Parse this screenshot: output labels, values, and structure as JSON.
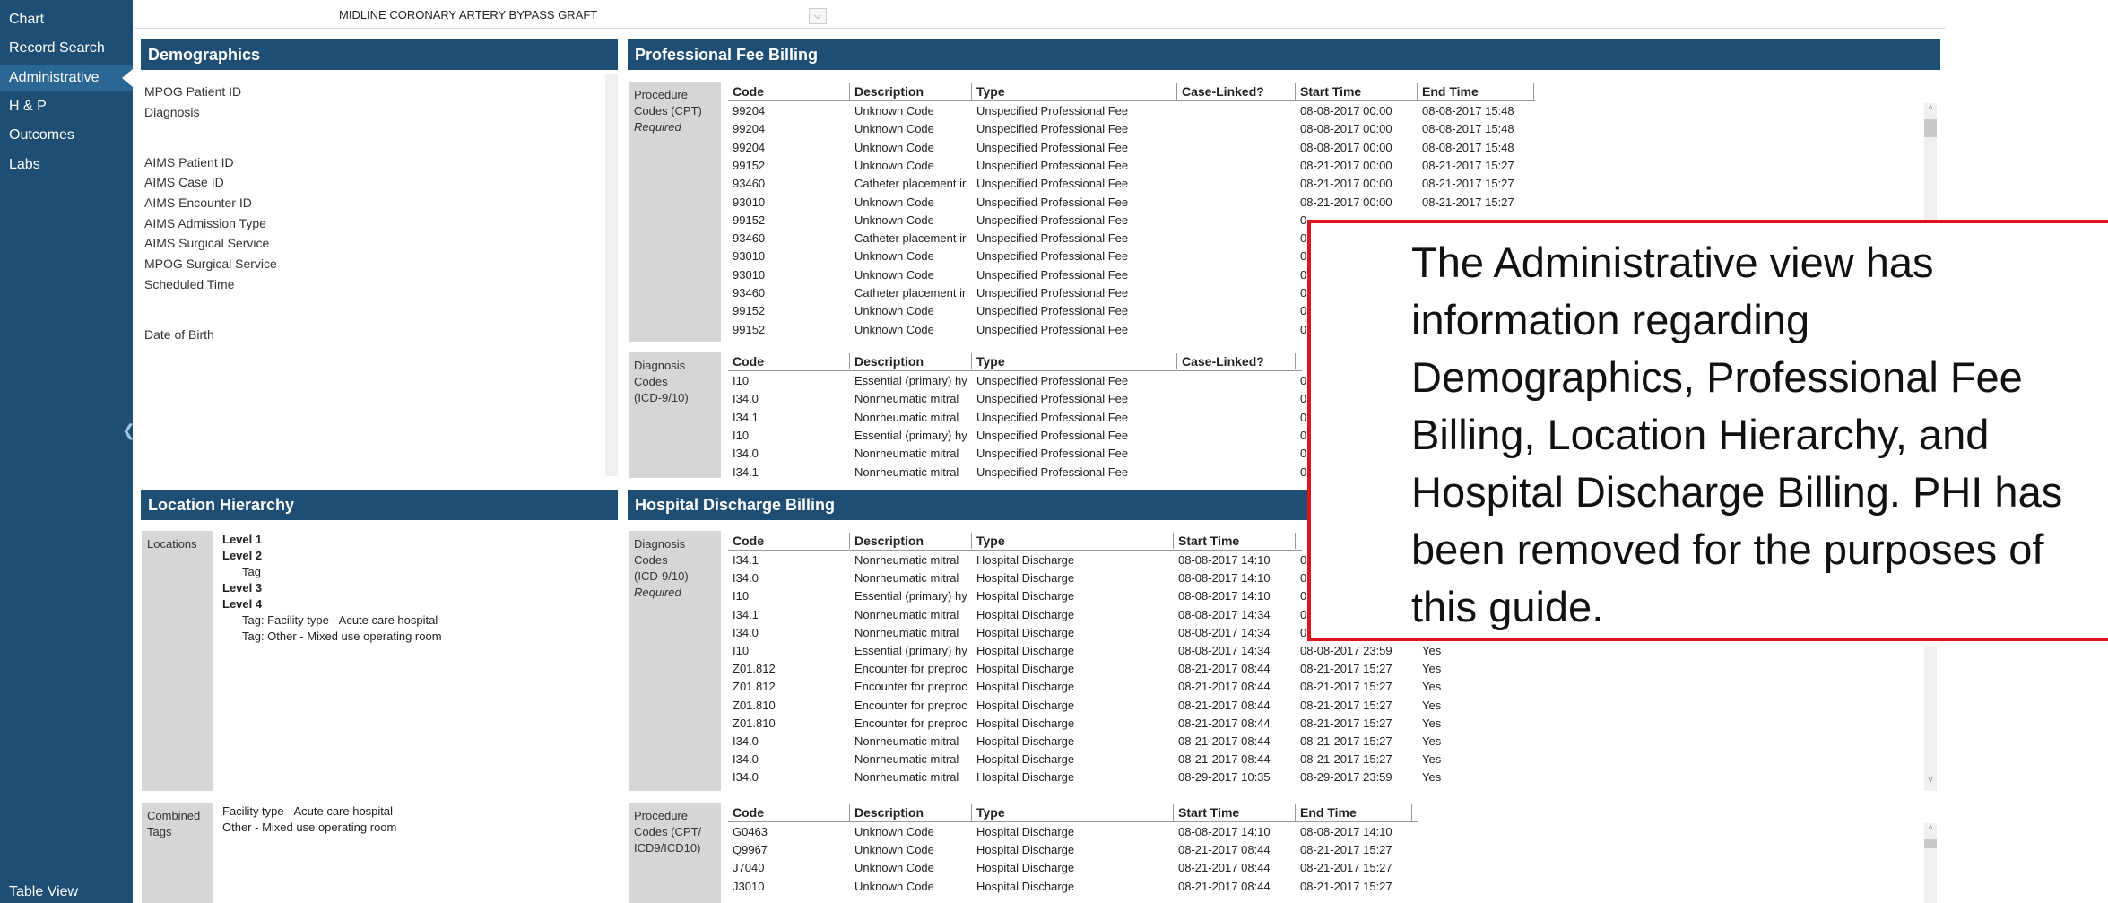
{
  "sidebar": {
    "items": [
      {
        "label": "Chart",
        "active": false
      },
      {
        "label": "Record Search",
        "active": false
      },
      {
        "label": "Administrative",
        "active": true
      },
      {
        "label": "H & P",
        "active": false
      },
      {
        "label": "Outcomes",
        "active": false
      },
      {
        "label": "Labs",
        "active": false
      }
    ],
    "collapse_icon": "chevron-left-icon",
    "table_view_label": "Table View"
  },
  "procedure_selector": {
    "value": "MIDLINE CORONARY ARTERY BYPASS GRAFT",
    "icon": "chevron-down-icon"
  },
  "demographics": {
    "title": "Demographics",
    "labels": [
      "MPOG Patient ID",
      "Diagnosis",
      "AIMS Patient ID",
      "AIMS Case ID",
      "AIMS Encounter ID",
      "AIMS Admission Type",
      "AIMS Surgical Service",
      "MPOG Surgical Service",
      "Scheduled Time",
      "Date of Birth"
    ]
  },
  "professional_fee_billing": {
    "title": "Professional Fee Billing",
    "procedure_label_1": "Procedure",
    "procedure_label_2": "Codes (CPT)",
    "procedure_label_3": "Required",
    "columns": [
      "Code",
      "Description",
      "Type",
      "Case-Linked?",
      "Start Time",
      "End Time"
    ],
    "procedure_rows": [
      [
        "99204",
        "Unknown Code",
        "Unspecified Professional Fee",
        "",
        "08-08-2017 00:00",
        "08-08-2017 15:48"
      ],
      [
        "99204",
        "Unknown Code",
        "Unspecified Professional Fee",
        "",
        "08-08-2017 00:00",
        "08-08-2017 15:48"
      ],
      [
        "99204",
        "Unknown Code",
        "Unspecified Professional Fee",
        "",
        "08-08-2017 00:00",
        "08-08-2017 15:48"
      ],
      [
        "99152",
        "Unknown Code",
        "Unspecified Professional Fee",
        "",
        "08-21-2017 00:00",
        "08-21-2017 15:27"
      ],
      [
        "93460",
        "Catheter placement ir",
        "Unspecified Professional Fee",
        "",
        "08-21-2017 00:00",
        "08-21-2017 15:27"
      ],
      [
        "93010",
        "Unknown Code",
        "Unspecified Professional Fee",
        "",
        "08-21-2017 00:00",
        "08-21-2017 15:27"
      ],
      [
        "99152",
        "Unknown Code",
        "Unspecified Professional Fee",
        "",
        "0",
        ""
      ],
      [
        "93460",
        "Catheter placement ir",
        "Unspecified Professional Fee",
        "",
        "0",
        ""
      ],
      [
        "93010",
        "Unknown Code",
        "Unspecified Professional Fee",
        "",
        "0",
        ""
      ],
      [
        "93010",
        "Unknown Code",
        "Unspecified Professional Fee",
        "",
        "0",
        ""
      ],
      [
        "93460",
        "Catheter placement ir",
        "Unspecified Professional Fee",
        "",
        "0",
        ""
      ],
      [
        "99152",
        "Unknown Code",
        "Unspecified Professional Fee",
        "",
        "0",
        ""
      ],
      [
        "99152",
        "Unknown Code",
        "Unspecified Professional Fee",
        "",
        "0",
        ""
      ]
    ],
    "diagnosis_label_1": "Diagnosis",
    "diagnosis_label_2": "Codes",
    "diagnosis_label_3": "(ICD-9/10)",
    "diagnosis_columns": [
      "Code",
      "Description",
      "Type",
      "Case-Linked?"
    ],
    "diagnosis_rows": [
      [
        "I10",
        "Essential (primary) hy",
        "Unspecified Professional Fee",
        "",
        "0"
      ],
      [
        "I34.0",
        "Nonrheumatic mitral",
        "Unspecified Professional Fee",
        "",
        "0"
      ],
      [
        "I34.1",
        "Nonrheumatic mitral",
        "Unspecified Professional Fee",
        "",
        "0"
      ],
      [
        "I10",
        "Essential (primary) hy",
        "Unspecified Professional Fee",
        "",
        "0"
      ],
      [
        "I34.0",
        "Nonrheumatic mitral",
        "Unspecified Professional Fee",
        "",
        "0"
      ],
      [
        "I34.1",
        "Nonrheumatic mitral",
        "Unspecified Professional Fee",
        "",
        "0"
      ]
    ]
  },
  "location_hierarchy": {
    "title": "Location Hierarchy",
    "locations_label": "Locations",
    "lines": [
      {
        "text": "Level 1",
        "bold": true,
        "indent": 0
      },
      {
        "text": "Level 2",
        "bold": true,
        "indent": 0
      },
      {
        "text": "Tag",
        "bold": false,
        "indent": 1
      },
      {
        "text": "Level 3",
        "bold": true,
        "indent": 0
      },
      {
        "text": "Level 4",
        "bold": true,
        "indent": 0
      },
      {
        "text": "Tag: Facility type - Acute care hospital",
        "bold": false,
        "indent": 1
      },
      {
        "text": "Tag: Other - Mixed use operating room",
        "bold": false,
        "indent": 1
      }
    ],
    "combined_label_1": "Combined",
    "combined_label_2": "Tags",
    "combined_tags": [
      "Facility type - Acute care hospital",
      "Other - Mixed use operating room"
    ]
  },
  "hospital_discharge_billing": {
    "title": "Hospital Discharge Billing",
    "diagnosis_label_1": "Diagnosis",
    "diagnosis_label_2": "Codes",
    "diagnosis_label_3": "(ICD-9/10)",
    "diagnosis_label_4": "Required",
    "columns": [
      "Code",
      "Description",
      "Type",
      "Start Time"
    ],
    "diagnosis_rows": [
      [
        "I34.1",
        "Nonrheumatic mitral",
        "Hospital Discharge",
        "08-08-2017 14:10",
        "0",
        ""
      ],
      [
        "I34.0",
        "Nonrheumatic mitral",
        "Hospital Discharge",
        "08-08-2017 14:10",
        "0",
        ""
      ],
      [
        "I10",
        "Essential (primary) hy",
        "Hospital Discharge",
        "08-08-2017 14:10",
        "0",
        ""
      ],
      [
        "I34.1",
        "Nonrheumatic mitral",
        "Hospital Discharge",
        "08-08-2017 14:34",
        "0",
        ""
      ],
      [
        "I34.0",
        "Nonrheumatic mitral",
        "Hospital Discharge",
        "08-08-2017 14:34",
        "0",
        ""
      ],
      [
        "I10",
        "Essential (primary) hy",
        "Hospital Discharge",
        "08-08-2017 14:34",
        "08-08-2017 23:59",
        "Yes"
      ],
      [
        "Z01.812",
        "Encounter for preproc",
        "Hospital Discharge",
        "08-21-2017 08:44",
        "08-21-2017 15:27",
        "Yes"
      ],
      [
        "Z01.812",
        "Encounter for preproc",
        "Hospital Discharge",
        "08-21-2017 08:44",
        "08-21-2017 15:27",
        "Yes"
      ],
      [
        "Z01.810",
        "Encounter for preproc",
        "Hospital Discharge",
        "08-21-2017 08:44",
        "08-21-2017 15:27",
        "Yes"
      ],
      [
        "Z01.810",
        "Encounter for preproc",
        "Hospital Discharge",
        "08-21-2017 08:44",
        "08-21-2017 15:27",
        "Yes"
      ],
      [
        "I34.0",
        "Nonrheumatic mitral",
        "Hospital Discharge",
        "08-21-2017 08:44",
        "08-21-2017 15:27",
        "Yes"
      ],
      [
        "I34.0",
        "Nonrheumatic mitral",
        "Hospital Discharge",
        "08-21-2017 08:44",
        "08-21-2017 15:27",
        "Yes"
      ],
      [
        "I34.0",
        "Nonrheumatic mitral",
        "Hospital Discharge",
        "08-29-2017 10:35",
        "08-29-2017 23:59",
        "Yes"
      ]
    ],
    "procedure_label_1": "Procedure",
    "procedure_label_2": "Codes (CPT/",
    "procedure_label_3": "ICD9/ICD10)",
    "procedure_columns": [
      "Code",
      "Description",
      "Type",
      "Start Time",
      "End Time"
    ],
    "procedure_rows": [
      [
        "G0463",
        "Unknown Code",
        "Hospital Discharge",
        "08-08-2017 14:10",
        "08-08-2017 14:10"
      ],
      [
        "Q9967",
        "Unknown Code",
        "Hospital Discharge",
        "08-21-2017 08:44",
        "08-21-2017 15:27"
      ],
      [
        "J7040",
        "Unknown Code",
        "Hospital Discharge",
        "08-21-2017 08:44",
        "08-21-2017 15:27"
      ],
      [
        "J3010",
        "Unknown Code",
        "Hospital Discharge",
        "08-21-2017 08:44",
        "08-21-2017 15:27"
      ]
    ]
  },
  "callout": {
    "text": "The Administrative view has information regarding Demographics, Professional Fee Billing, Location Hierarchy, and Hospital Discharge Billing. PHI has been removed for the purposes of this guide."
  },
  "colors": {
    "header": "#1e4e74",
    "sidebar": "#1e4e74",
    "callout_border": "#e0141e"
  }
}
